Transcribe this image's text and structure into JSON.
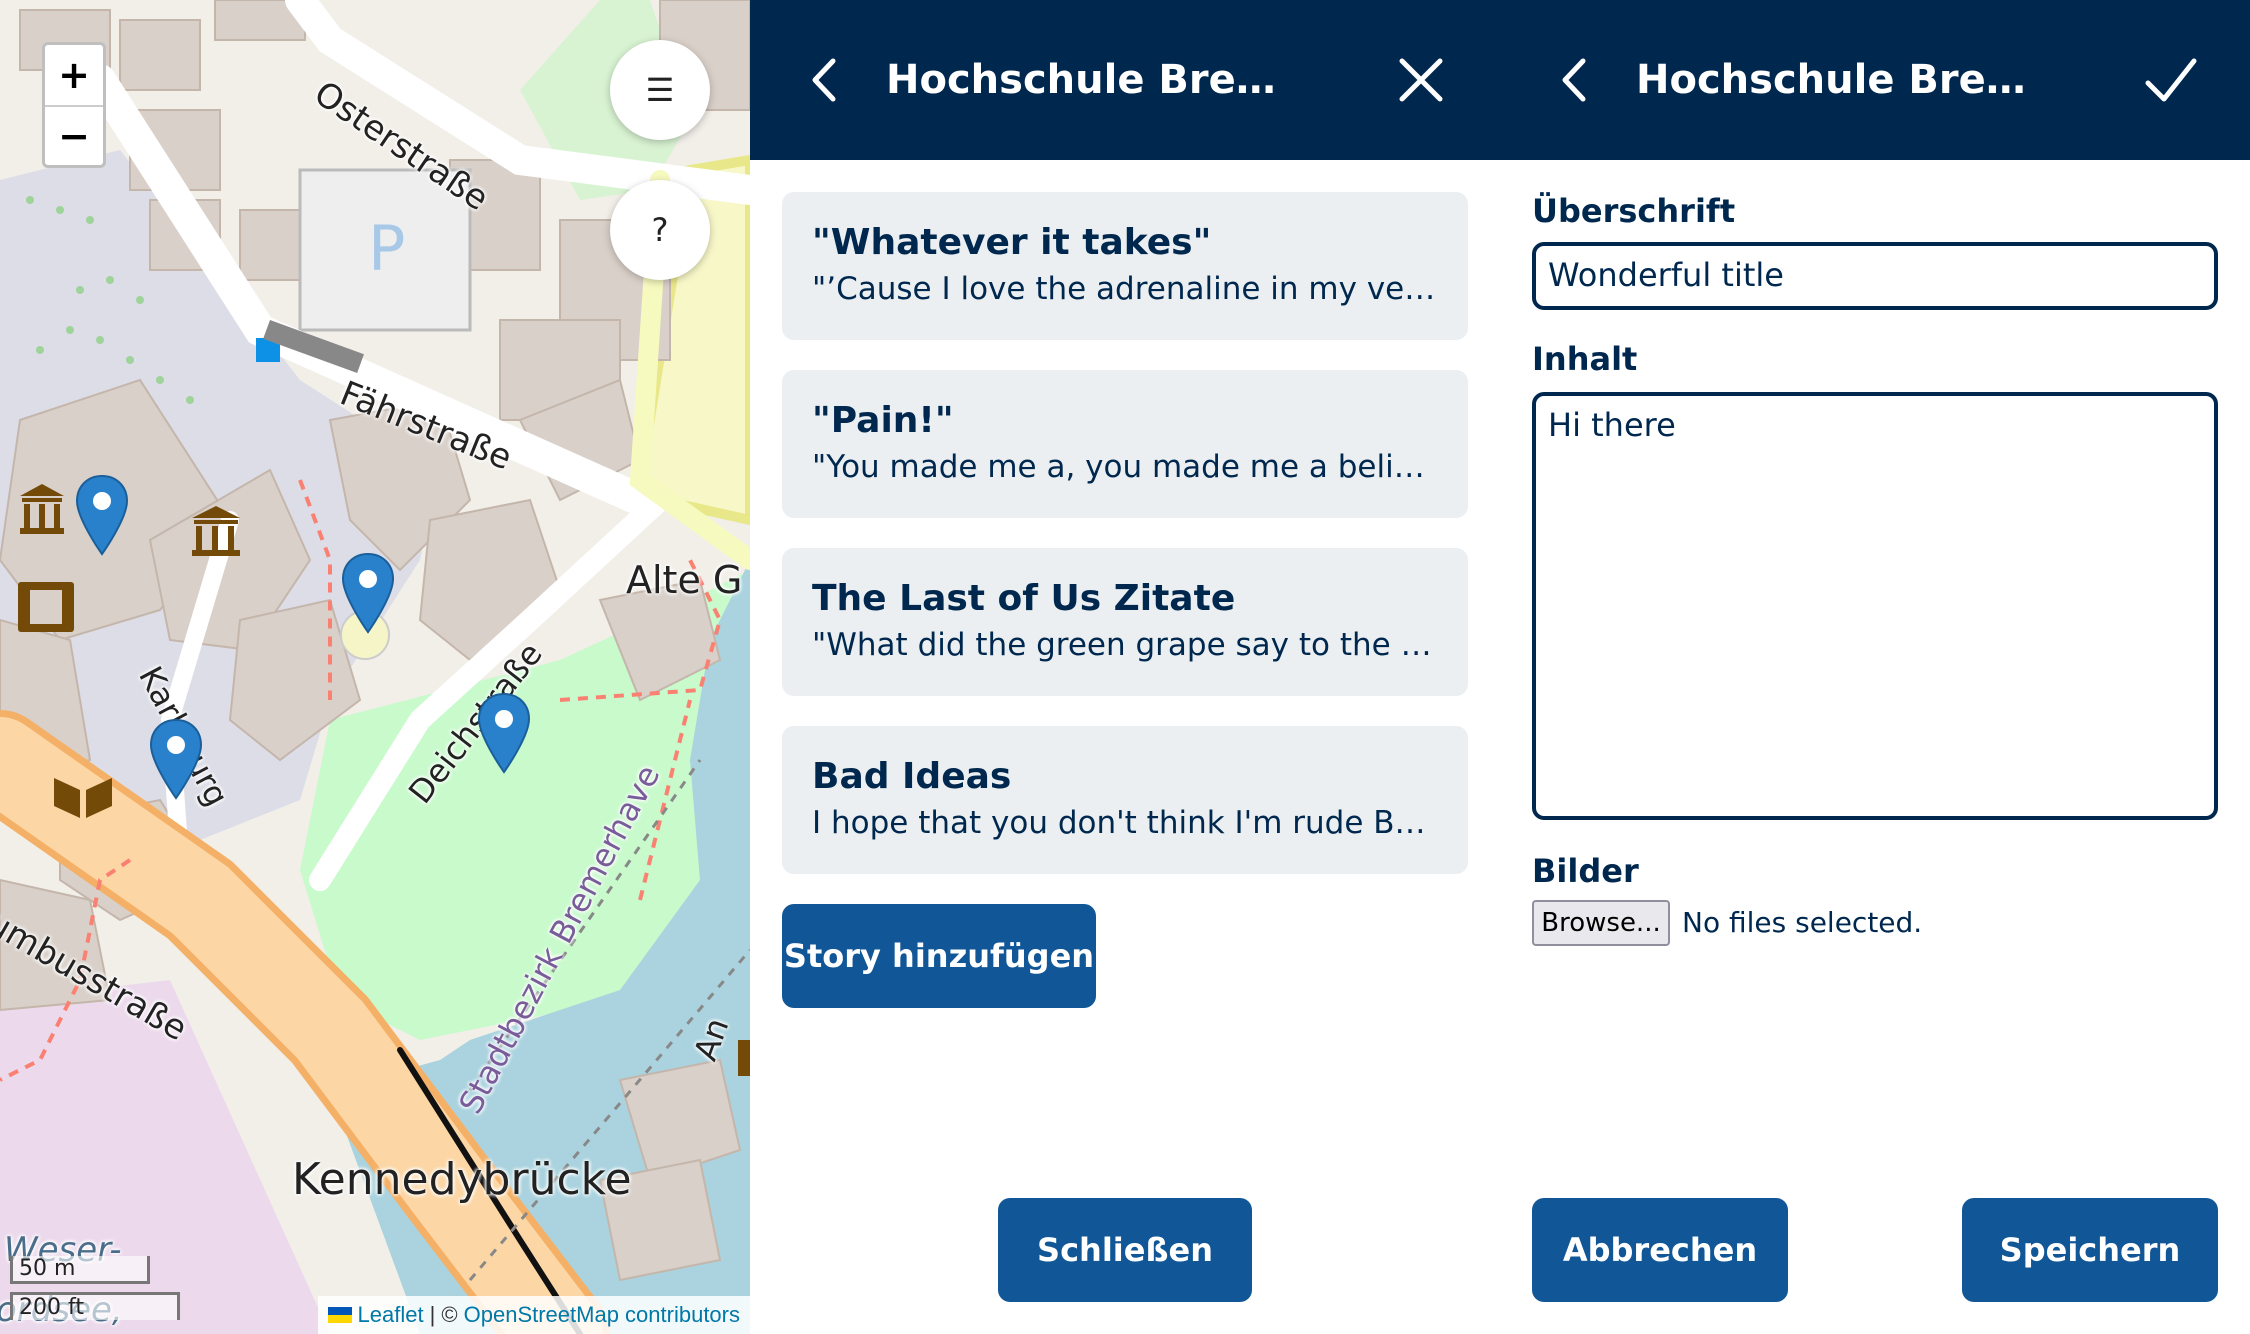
{
  "map": {
    "zoom_in": "+",
    "zoom_out": "−",
    "menu_icon": "☰",
    "help_icon": "?",
    "streets": {
      "osterstrasse": "Osterstraße",
      "faehrstrasse": "Fährstraße",
      "karlsburg": "Karlsburg",
      "deichstrasse": "Deichstraße",
      "columbusstrasse": "umbusstraße",
      "alte": "Alte G",
      "kennedybruecke": "Kennedybrücke",
      "stadtbezirk": "Stadtbezirk Bremerhave",
      "weser": "Weser-",
      "nordsee": "ordsee,",
      "an": "An"
    },
    "parking": "P",
    "scale_metric": "50 m",
    "scale_imperial": "200 ft",
    "attribution": {
      "leaflet": "Leaflet",
      "separator": "| ©",
      "osm": "OpenStreetMap contributors"
    }
  },
  "list_panel": {
    "title": "Hochschule Bremerhaven",
    "stories": [
      {
        "title": "\"Whatever it takes\"",
        "content": "\"’Cause I love the adrenaline in my veins\""
      },
      {
        "title": "\"Pain!\"",
        "content": "\"You made me a, you made me a believer, believer\""
      },
      {
        "title": "The Last of Us Zitate",
        "content": "\"What did the green grape say to the purple grape?\""
      },
      {
        "title": "Bad Ideas",
        "content": "I hope that you don't think I'm rude But I really need to go"
      }
    ],
    "add_button": "Story hinzufügen",
    "close_button": "Schließen"
  },
  "edit_panel": {
    "title": "Hochschule Bremerhaven",
    "heading_label": "Überschrift",
    "heading_value": "Wonderful title",
    "content_label": "Inhalt",
    "content_value": "Hi there",
    "images_label": "Bilder",
    "browse_button": "Browse...",
    "file_status": "No files selected.",
    "cancel_button": "Abbrechen",
    "save_button": "Speichern"
  },
  "colors": {
    "header": "#00284f",
    "primary": "#115797",
    "card": "#ebeff1",
    "marker": "#2a81cb"
  }
}
